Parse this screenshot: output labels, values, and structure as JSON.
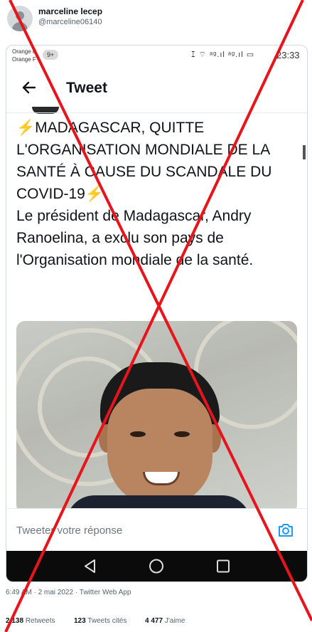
{
  "post": {
    "display_name": "marceline lecep",
    "handle": "@marceline06140",
    "timestamp": "6:49 AM · 2 mai 2022 · Twitter Web App",
    "stats": {
      "retweets_count": "2 138",
      "retweets_label": "Retweets",
      "quotes_count": "123",
      "quotes_label": "Tweets cités",
      "likes_count": "4 477",
      "likes_label": "J'aime"
    }
  },
  "phone": {
    "status": {
      "carrier_1": "Orange F",
      "carrier_2": "Orange F",
      "badge": "9+",
      "icons": "ꕯ ⌔ ᵃᵍ.ıl ᵃᵍ.ıl ▭",
      "time": "23:33"
    },
    "top_bar": {
      "back_icon": "arrow-left-icon",
      "title": "Tweet"
    },
    "tweet": {
      "headline": "MADAGASCAR, QUITTE L'ORGANISATION MONDIALE DE LA SANTÉ À CAUSE DU SCANDALE DU COVID-19",
      "headline_end": ".",
      "body": "Le président de Madagascar, Andry Ranoelina, a exclu son pays de l'Organisation mondiale de la santé.",
      "emoji_icon": "lightning-bolt-icon",
      "bolt_glyph": "⚡"
    },
    "reply_bar": {
      "placeholder": "Tweeter votre réponse",
      "camera_icon": "camera-icon"
    },
    "nav_bar": {
      "back_icon": "triangle-back-icon",
      "home_icon": "circle-home-icon",
      "recent_icon": "square-recent-icon"
    }
  },
  "overlay": {
    "type": "red-cross-mark",
    "color": "#e8141b"
  }
}
